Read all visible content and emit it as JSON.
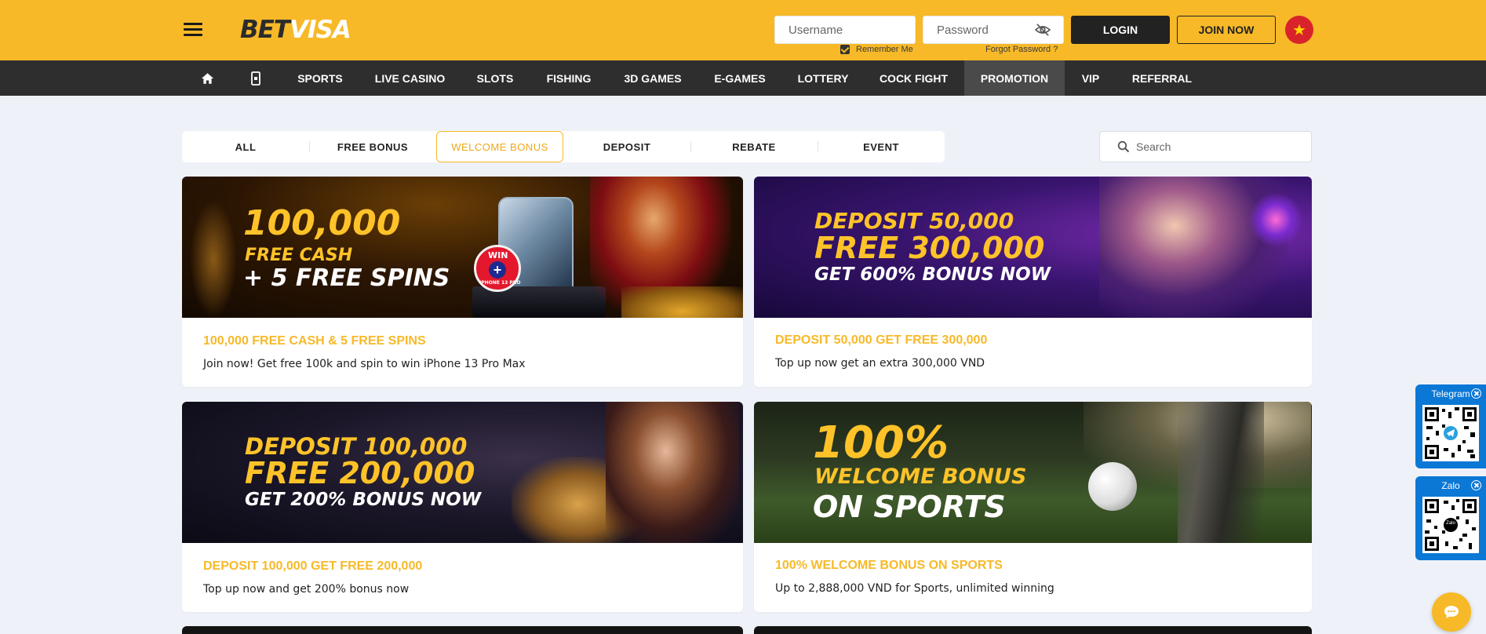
{
  "brand": {
    "logo_part1": "BET",
    "logo_part2": "VISA"
  },
  "login": {
    "username_placeholder": "Username",
    "password_placeholder": "Password",
    "remember_label": "Remember Me",
    "forgot_label": "Forgot Password ?",
    "login_label": "LOGIN",
    "join_label": "JOIN NOW"
  },
  "nav": {
    "items": [
      "SPORTS",
      "LIVE CASINO",
      "SLOTS",
      "FISHING",
      "3D GAMES",
      "E-GAMES",
      "LOTTERY",
      "COCK FIGHT",
      "PROMOTION",
      "VIP",
      "REFERRAL"
    ],
    "active": "PROMOTION",
    "icons": [
      "home-icon",
      "mobile-icon"
    ]
  },
  "filters": {
    "tabs": [
      "ALL",
      "FREE BONUS",
      "WELCOME BONUS",
      "DEPOSIT",
      "REBATE",
      "EVENT"
    ],
    "active": "WELCOME BONUS",
    "search_placeholder": "Search"
  },
  "promotions": [
    {
      "title": "100,000 FREE CASH & 5 FREE SPINS",
      "description": "Join now! Get free 100k and spin to win iPhone 13 Pro Max",
      "banner": {
        "line1": "100,000",
        "line2": "FREE CASH",
        "line3": "+ 5 FREE SPINS",
        "badge_top": "WIN",
        "badge_bottom": "IPHONE 13 PRO"
      }
    },
    {
      "title": "DEPOSIT 50,000 GET FREE 300,000",
      "description": "Top up now get an extra 300,000 VND",
      "banner": {
        "line1": "DEPOSIT 50,000",
        "line2": "FREE 300,000",
        "line3": "GET 600% BONUS NOW"
      }
    },
    {
      "title": "DEPOSIT 100,000 GET FREE 200,000",
      "description": "Top up now and get 200% bonus now",
      "banner": {
        "line1": "DEPOSIT 100,000",
        "line2": "FREE 200,000",
        "line3": "GET 200% BONUS NOW"
      }
    },
    {
      "title": "100% WELCOME BONUS ON SPORTS",
      "description": "Up to 2,888,000 VND for Sports, unlimited winning",
      "banner": {
        "line1": "100%",
        "line2": "WELCOME BONUS",
        "line3": "ON SPORTS"
      }
    }
  ],
  "widgets": {
    "telegram_label": "Telegram",
    "zalo_label": "Zalo",
    "zalo_qr_center": "Zalo"
  },
  "colors": {
    "accent": "#f7b928",
    "nav_bg": "#2e2e2e",
    "page_bg": "#eef2f8",
    "widget_blue": "#0b78d6"
  }
}
